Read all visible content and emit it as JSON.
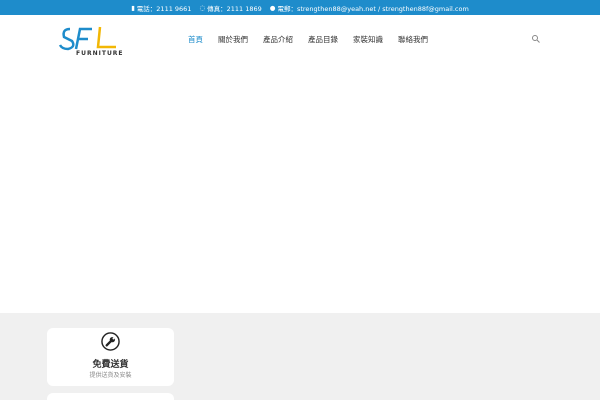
{
  "topbar": {
    "phone": "電話：2111 9661",
    "fax": "傳真：2111 1869",
    "email": "電郵：strengthen88@yeah.net / strengthen88f@gmail.com"
  },
  "logo": {
    "text": "SFL",
    "subtext": "FURNITURE"
  },
  "nav": {
    "items": [
      {
        "label": "首頁"
      },
      {
        "label": "關於我們"
      },
      {
        "label": "產品介紹"
      },
      {
        "label": "產品目錄"
      },
      {
        "label": "家裝知識"
      },
      {
        "label": "聯絡我們"
      }
    ]
  },
  "features": [
    {
      "title": "免費送貨",
      "subtitle": "提供送貨及安裝",
      "icon": "wrench-icon"
    }
  ],
  "colors": {
    "accent": "#1e8ccb",
    "logo_yellow": "#f2b705"
  }
}
